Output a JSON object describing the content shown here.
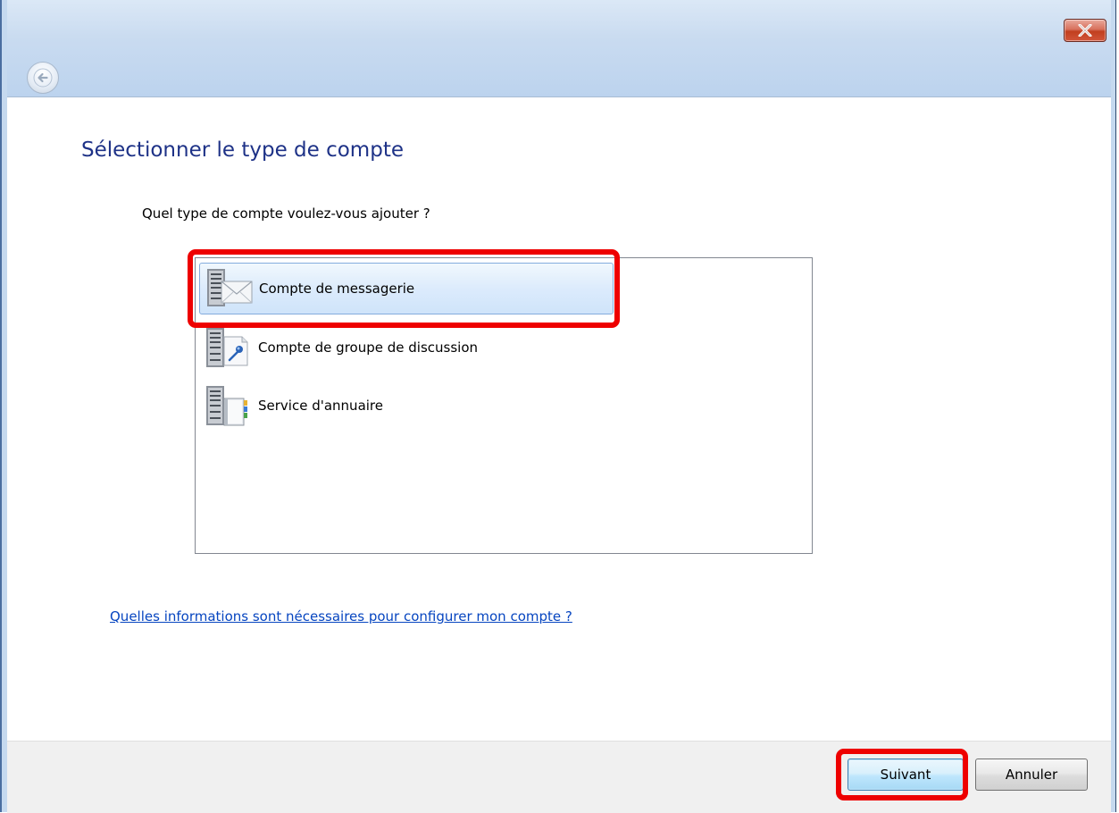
{
  "dialog": {
    "title": "Sélectionner le type de compte",
    "question": "Quel type de compte voulez-vous ajouter ?",
    "help_link": "Quelles informations sont nécessaires pour configurer mon compte ?"
  },
  "account_types": [
    {
      "label": "Compte de messagerie",
      "icon": "server-mail-icon",
      "selected": true
    },
    {
      "label": "Compte de groupe de discussion",
      "icon": "server-newsgroup-icon",
      "selected": false
    },
    {
      "label": "Service d'annuaire",
      "icon": "server-directory-icon",
      "selected": false
    }
  ],
  "buttons": {
    "next": "Suivant",
    "cancel": "Annuler"
  },
  "colors": {
    "title": "#1e3287",
    "link": "#0645c0",
    "highlight": "#ee0000",
    "selection": "#cfe4fa"
  }
}
